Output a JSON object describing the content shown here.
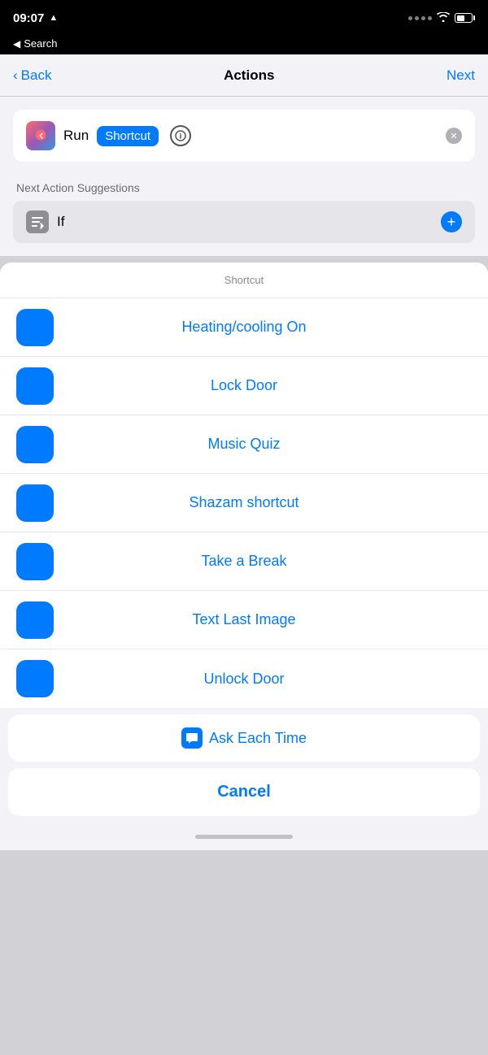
{
  "statusBar": {
    "time": "09:07",
    "locationArrow": "▲"
  },
  "searchBar": {
    "backLabel": "Search"
  },
  "navBar": {
    "backLabel": "Back",
    "title": "Actions",
    "nextLabel": "Next"
  },
  "runShortcut": {
    "runLabel": "Run",
    "shortcutBadge": "Shortcut"
  },
  "suggestions": {
    "sectionLabel": "Next Action Suggestions",
    "ifLabel": "If"
  },
  "sheet": {
    "title": "Shortcut",
    "items": [
      {
        "label": "Heating/cooling On"
      },
      {
        "label": "Lock Door"
      },
      {
        "label": "Music Quiz"
      },
      {
        "label": "Shazam shortcut"
      },
      {
        "label": "Take a Break"
      },
      {
        "label": "Text Last Image"
      },
      {
        "label": "Unlock Door"
      }
    ],
    "askEachTime": "Ask Each Time",
    "cancelLabel": "Cancel"
  }
}
